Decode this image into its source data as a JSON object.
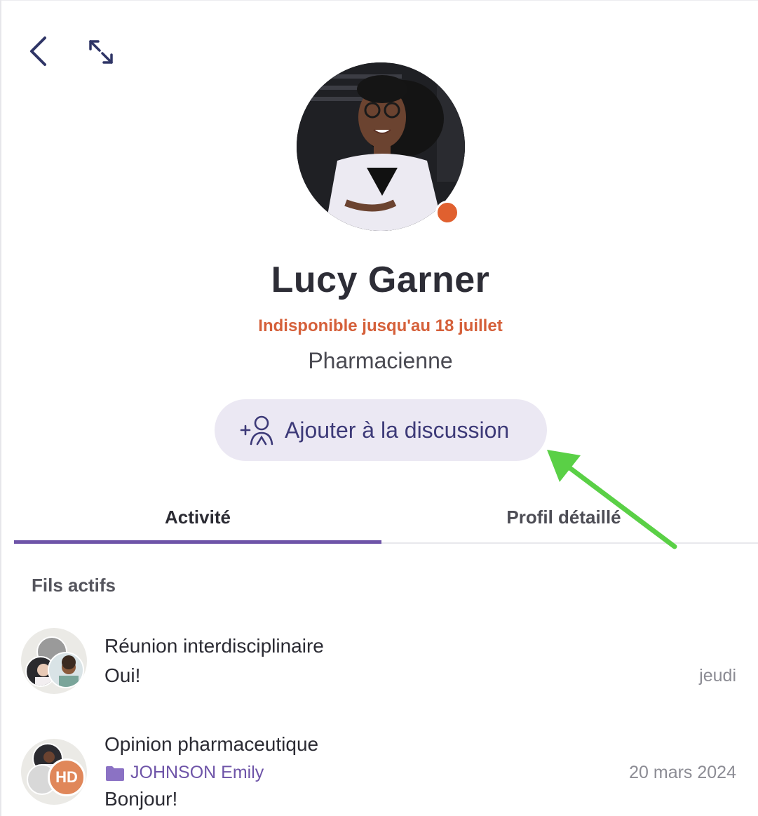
{
  "header": {
    "back_icon": "chevron-left-icon",
    "expand_icon": "expand-icon"
  },
  "profile": {
    "name": "Lucy Garner",
    "availability": "Indisponible jusqu'au 18 juillet",
    "role": "Pharmacienne",
    "status_color": "#e0602f"
  },
  "actions": {
    "add_to_discussion": "Ajouter à la discussion"
  },
  "tabs": [
    {
      "label": "Activité",
      "active": true
    },
    {
      "label": "Profil détaillé",
      "active": false
    }
  ],
  "activity": {
    "section_title": "Fils actifs",
    "threads": [
      {
        "title": "Réunion interdisciplinaire",
        "last_message": "Oui!",
        "date": "jeudi"
      },
      {
        "title": "Opinion pharmaceutique",
        "folder_icon": "folder-icon",
        "patient": "JOHNSON Emily",
        "avatar_initials": "HD",
        "last_message": "Bonjour!",
        "date": "20 mars 2024"
      }
    ]
  },
  "colors": {
    "accent": "#6e54a8",
    "button_bg": "#ebe8f3",
    "button_text": "#3d3a78",
    "warning": "#d5603a"
  }
}
